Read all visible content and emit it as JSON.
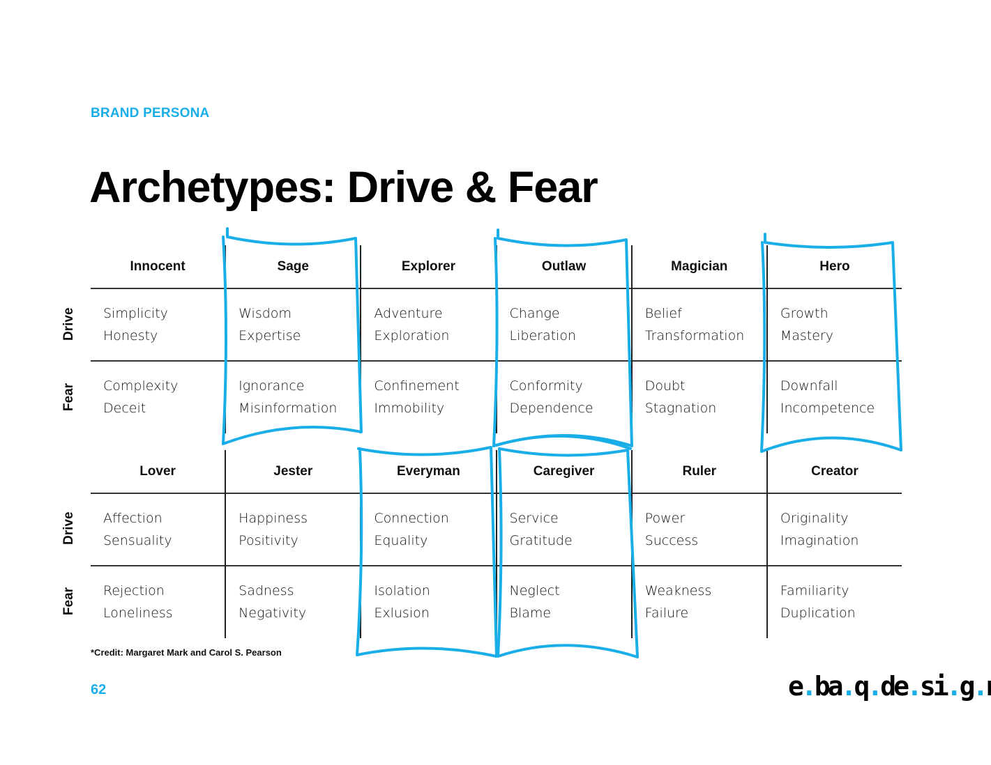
{
  "header": {
    "eyebrow": "BRAND PERSONA",
    "title": "Archetypes: Drive & Fear"
  },
  "row_labels": {
    "drive": "Drive",
    "fear": "Fear"
  },
  "groups": [
    {
      "archetypes": [
        {
          "name": "Innocent",
          "drive": [
            "Simplicity",
            "Honesty"
          ],
          "fear": [
            "Complexity",
            "Deceit"
          ],
          "highlighted": false
        },
        {
          "name": "Sage",
          "drive": [
            "Wisdom",
            "Expertise"
          ],
          "fear": [
            "Ignorance",
            "Misinformation"
          ],
          "highlighted": true
        },
        {
          "name": "Explorer",
          "drive": [
            "Adventure",
            "Exploration"
          ],
          "fear": [
            "Confinement",
            "Immobility"
          ],
          "highlighted": false
        },
        {
          "name": "Outlaw",
          "drive": [
            "Change",
            "Liberation"
          ],
          "fear": [
            "Conformity",
            "Dependence"
          ],
          "highlighted": true
        },
        {
          "name": "Magician",
          "drive": [
            "Belief",
            "Transformation"
          ],
          "fear": [
            "Doubt",
            "Stagnation"
          ],
          "highlighted": false
        },
        {
          "name": "Hero",
          "drive": [
            "Growth",
            "Mastery"
          ],
          "fear": [
            "Downfall",
            "Incompetence"
          ],
          "highlighted": true
        }
      ]
    },
    {
      "archetypes": [
        {
          "name": "Lover",
          "drive": [
            "Affection",
            "Sensuality"
          ],
          "fear": [
            "Rejection",
            "Loneliness"
          ],
          "highlighted": false
        },
        {
          "name": "Jester",
          "drive": [
            "Happiness",
            "Positivity"
          ],
          "fear": [
            "Sadness",
            "Negativity"
          ],
          "highlighted": false
        },
        {
          "name": "Everyman",
          "drive": [
            "Connection",
            "Equality"
          ],
          "fear": [
            "Isolation",
            "Exlusion"
          ],
          "highlighted": true
        },
        {
          "name": "Caregiver",
          "drive": [
            "Service",
            "Gratitude"
          ],
          "fear": [
            "Neglect",
            "Blame"
          ],
          "highlighted": true
        },
        {
          "name": "Ruler",
          "drive": [
            "Power",
            "Success"
          ],
          "fear": [
            "Weakness",
            "Failure"
          ],
          "highlighted": false
        },
        {
          "name": "Creator",
          "drive": [
            "Originality",
            "Imagination"
          ],
          "fear": [
            "Familiarity",
            "Duplication"
          ],
          "highlighted": false
        }
      ]
    }
  ],
  "footer": {
    "credit": "*Credit: Margaret Mark and Carol S. Pearson",
    "page_number": "62",
    "logo_text": [
      "e",
      ".",
      "b",
      "a",
      ".",
      "q",
      ".",
      "d",
      "e",
      ".",
      "s",
      "i",
      ".",
      "g",
      ".",
      "n"
    ]
  },
  "colors": {
    "accent": "#1aaee8",
    "text": "#0d0d0d"
  }
}
